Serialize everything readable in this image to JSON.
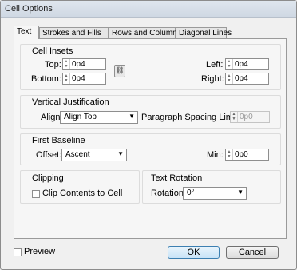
{
  "window": {
    "title": "Cell Options"
  },
  "tabs": [
    "Text",
    "Strokes and Fills",
    "Rows and Columns",
    "Diagonal Lines"
  ],
  "cell_insets": {
    "title": "Cell Insets",
    "top_label": "Top:",
    "top_value": "0p4",
    "bottom_label": "Bottom:",
    "bottom_value": "0p4",
    "left_label": "Left:",
    "left_value": "0p4",
    "right_label": "Right:",
    "right_value": "0p4"
  },
  "vertical_justification": {
    "title": "Vertical Justification",
    "align_label": "Align:",
    "align_value": "Align Top",
    "paragraph_spacing_label": "Paragraph Spacing Limit:",
    "paragraph_spacing_value": "0p0"
  },
  "first_baseline": {
    "title": "First Baseline",
    "offset_label": "Offset:",
    "offset_value": "Ascent",
    "min_label": "Min:",
    "min_value": "0p0"
  },
  "clipping": {
    "title": "Clipping",
    "clip_label": "Clip Contents to Cell"
  },
  "text_rotation": {
    "title": "Text Rotation",
    "rotation_label": "Rotation:",
    "rotation_value": "0°"
  },
  "footer": {
    "preview_label": "Preview",
    "ok_label": "OK",
    "cancel_label": "Cancel"
  }
}
